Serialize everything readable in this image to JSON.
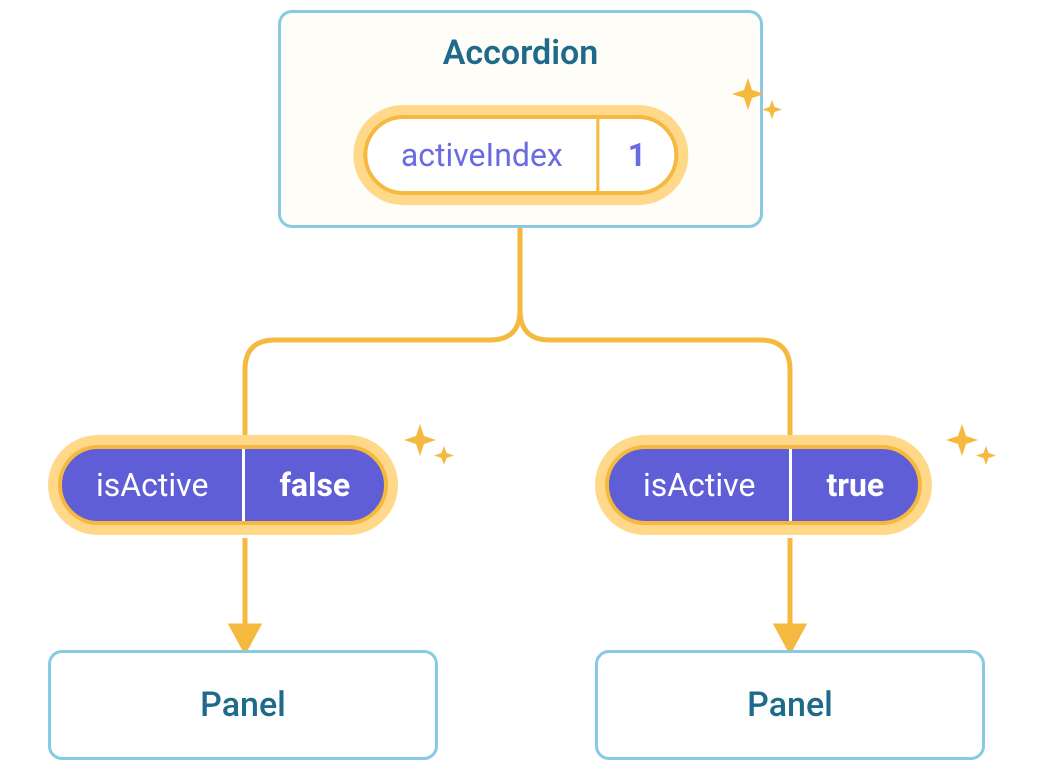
{
  "colors": {
    "boxBorder": "#88C9E3",
    "boxBg": "#FEFDF8",
    "titleText": "#1E6A8A",
    "pillOuter": "#FFD889",
    "pillBorder": "#F4B93E",
    "pillPurple": "#5F5ED7",
    "pillPurpleText": "#FFFFFF",
    "pillWhiteText": "#6B6AE0",
    "connector": "#F4B93E"
  },
  "parent": {
    "title": "Accordion",
    "state": {
      "label": "activeIndex",
      "value": "1"
    }
  },
  "children": [
    {
      "prop": {
        "label": "isActive",
        "value": "false"
      },
      "panelLabel": "Panel"
    },
    {
      "prop": {
        "label": "isActive",
        "value": "true"
      },
      "panelLabel": "Panel"
    }
  ]
}
